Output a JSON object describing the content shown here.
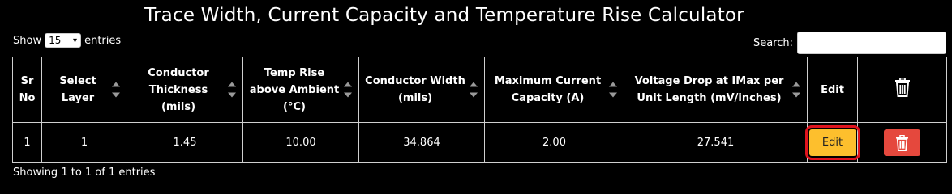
{
  "page": {
    "title": "Trace Width, Current Capacity and Temperature Rise Calculator"
  },
  "length": {
    "label_show": "Show",
    "value": "15",
    "label_entries": "entries"
  },
  "search": {
    "label": "Search:",
    "value": ""
  },
  "table": {
    "columns": [
      "Sr No",
      "Select Layer",
      "Conductor Thickness (mils)",
      "Temp Rise above Ambient (°C)",
      "Conductor Width (mils)",
      "Maximum Current Capacity (A)",
      "Voltage Drop at IMax per Unit Length (mV/inches)",
      "Edit",
      "trash-icon"
    ],
    "rows": [
      {
        "sr": "1",
        "layer": "1",
        "thickness": "1.45",
        "temp_rise": "10.00",
        "width": "34.864",
        "current": "2.00",
        "voltage_drop": "27.541",
        "edit_label": "Edit"
      }
    ]
  },
  "footer": {
    "info": "Showing 1 to 1 of 1 entries"
  },
  "colors": {
    "background": "#000000",
    "edit_button": "#fdbf2d",
    "delete_button": "#e5483d",
    "highlight": "#e0141e"
  }
}
